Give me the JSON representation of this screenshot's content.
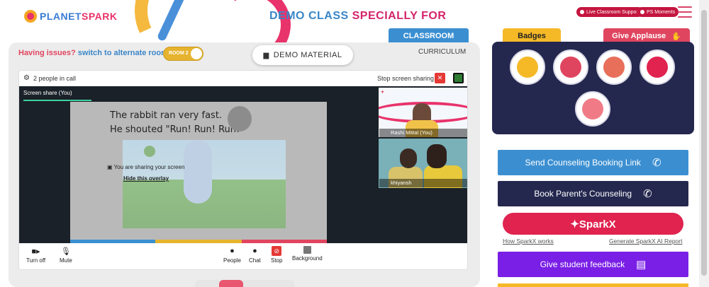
{
  "header": {
    "logo_text_a": "PLANET",
    "logo_text_b": "SPARK",
    "title_a": "DEMO CLASS",
    "title_b": "SPECIALLY FOR",
    "live_support": "Live Classroom Support",
    "ps_moments": "PS Moments"
  },
  "tabs": {
    "classroom": "CLASSROOM",
    "curriculum": "CURRICULUM"
  },
  "class_panel": {
    "issue_text": "Having issues?",
    "issue_link": "switch to alternate room",
    "room_toggle": "ROOM 2",
    "demo_material": "DEMO MATERIAL"
  },
  "meet": {
    "people_count": "2 people in call",
    "stop_sharing": "Stop screen sharing",
    "screen_share_label": "Screen share (You)",
    "slide_line1": "The rabbit ran very fast.",
    "slide_line2": "He shouted \"Run! Run! Run!\"",
    "overlay_text": "You are sharing your screen",
    "overlay_link": "Hide this overlay",
    "participants": [
      {
        "name": "Rashi Mittal (You)"
      },
      {
        "name": "khiyansh"
      }
    ],
    "controls": {
      "turn_off": "Turn off",
      "mute": "Mute",
      "people": "People",
      "chat": "Chat",
      "stop": "Stop",
      "background": "Background"
    }
  },
  "right_panel": {
    "badges_tab": "Badges",
    "applause_tab": "Give Applause",
    "send_counseling": "Send Counseling Booking Link",
    "book_counseling": "Book Parent's Counseling",
    "sparkx": "✦SparkX",
    "how_sparkx": "How SparkX works",
    "generate_report": "Generate SparkX AI Report",
    "student_feedback": "Give student feedback"
  },
  "colors": {
    "brand_pink": "#e0234f",
    "brand_blue": "#3b8fd1",
    "navy": "#24284f",
    "purple": "#7a1fe6"
  }
}
